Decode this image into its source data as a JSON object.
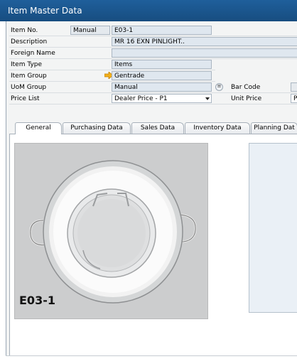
{
  "window": {
    "title": "Item Master Data"
  },
  "form": {
    "item_no": {
      "label": "Item No.",
      "series": "Manual",
      "value": "E03-1"
    },
    "description": {
      "label": "Description",
      "value": "MR 16 EXN PINLIGHT.."
    },
    "foreign_name": {
      "label": "Foreign Name",
      "value": ""
    },
    "item_type": {
      "label": "Item Type",
      "value": "Items"
    },
    "item_group": {
      "label": "Item Group",
      "value": "Gentrade"
    },
    "uom_group": {
      "label": "UoM Group",
      "value": "Manual"
    },
    "bar_code": {
      "label": "Bar Code",
      "value": ""
    },
    "price_list": {
      "label": "Price List",
      "value": "Dealer Price - P1"
    },
    "unit_price": {
      "label": "Unit Price",
      "value": "Pr"
    }
  },
  "tabs": [
    {
      "label": "General"
    },
    {
      "label": "Purchasing Data"
    },
    {
      "label": "Sales Data"
    },
    {
      "label": "Inventory Data"
    },
    {
      "label": "Planning Dat"
    }
  ],
  "general": {
    "image_caption": "E03-1"
  },
  "icons": {
    "item_group_link": "orange-arrow-icon",
    "uom_group_browse": "ellipsis-icon",
    "price_list_dropdown": "chevron-down-icon"
  }
}
